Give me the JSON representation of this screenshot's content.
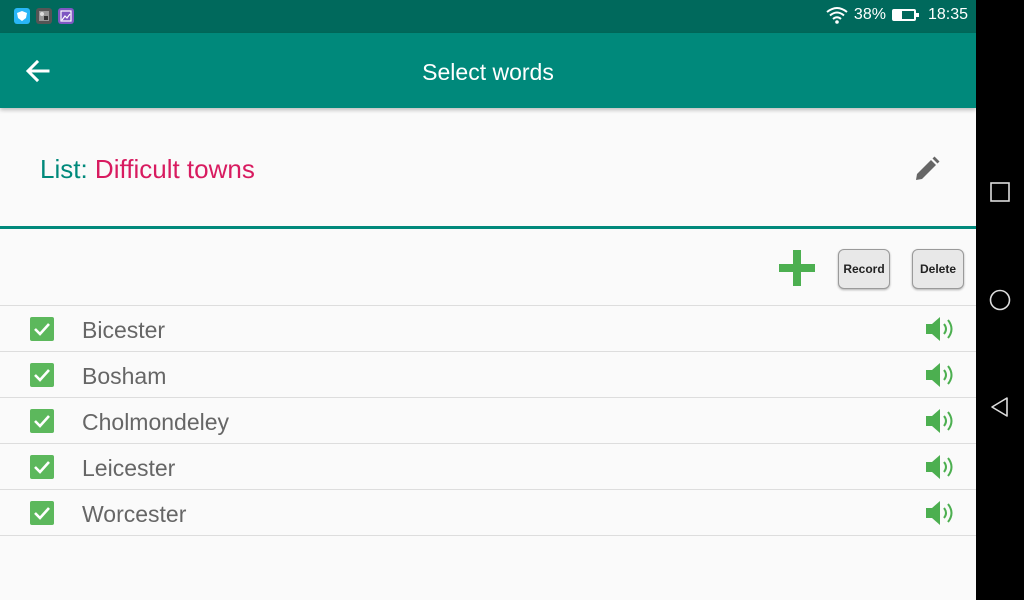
{
  "status_bar": {
    "battery_percent": "38%",
    "battery_level": 0.38,
    "time": "18:35",
    "notification_icons": [
      "shield-app-icon",
      "photo-app-icon",
      "gallery-app-icon"
    ]
  },
  "app_bar": {
    "title": "Select words",
    "back_icon": "arrow-left-icon"
  },
  "list_header": {
    "prefix": "List: ",
    "name": "Difficult towns",
    "edit_icon": "pencil-icon"
  },
  "toolbar": {
    "add_icon": "plus-icon",
    "record_label": "Record",
    "delete_label": "Delete"
  },
  "words": [
    {
      "text": "Bicester",
      "checked": true
    },
    {
      "text": "Bosham",
      "checked": true
    },
    {
      "text": "Cholmondeley",
      "checked": true
    },
    {
      "text": "Leicester",
      "checked": true
    },
    {
      "text": "Worcester",
      "checked": true
    }
  ],
  "colors": {
    "status_bar": "#00695c",
    "app_bar": "#00897b",
    "list_prefix": "#00897b",
    "list_name": "#d81b60",
    "checkbox": "#5cb85c",
    "speaker": "#4caf50"
  }
}
